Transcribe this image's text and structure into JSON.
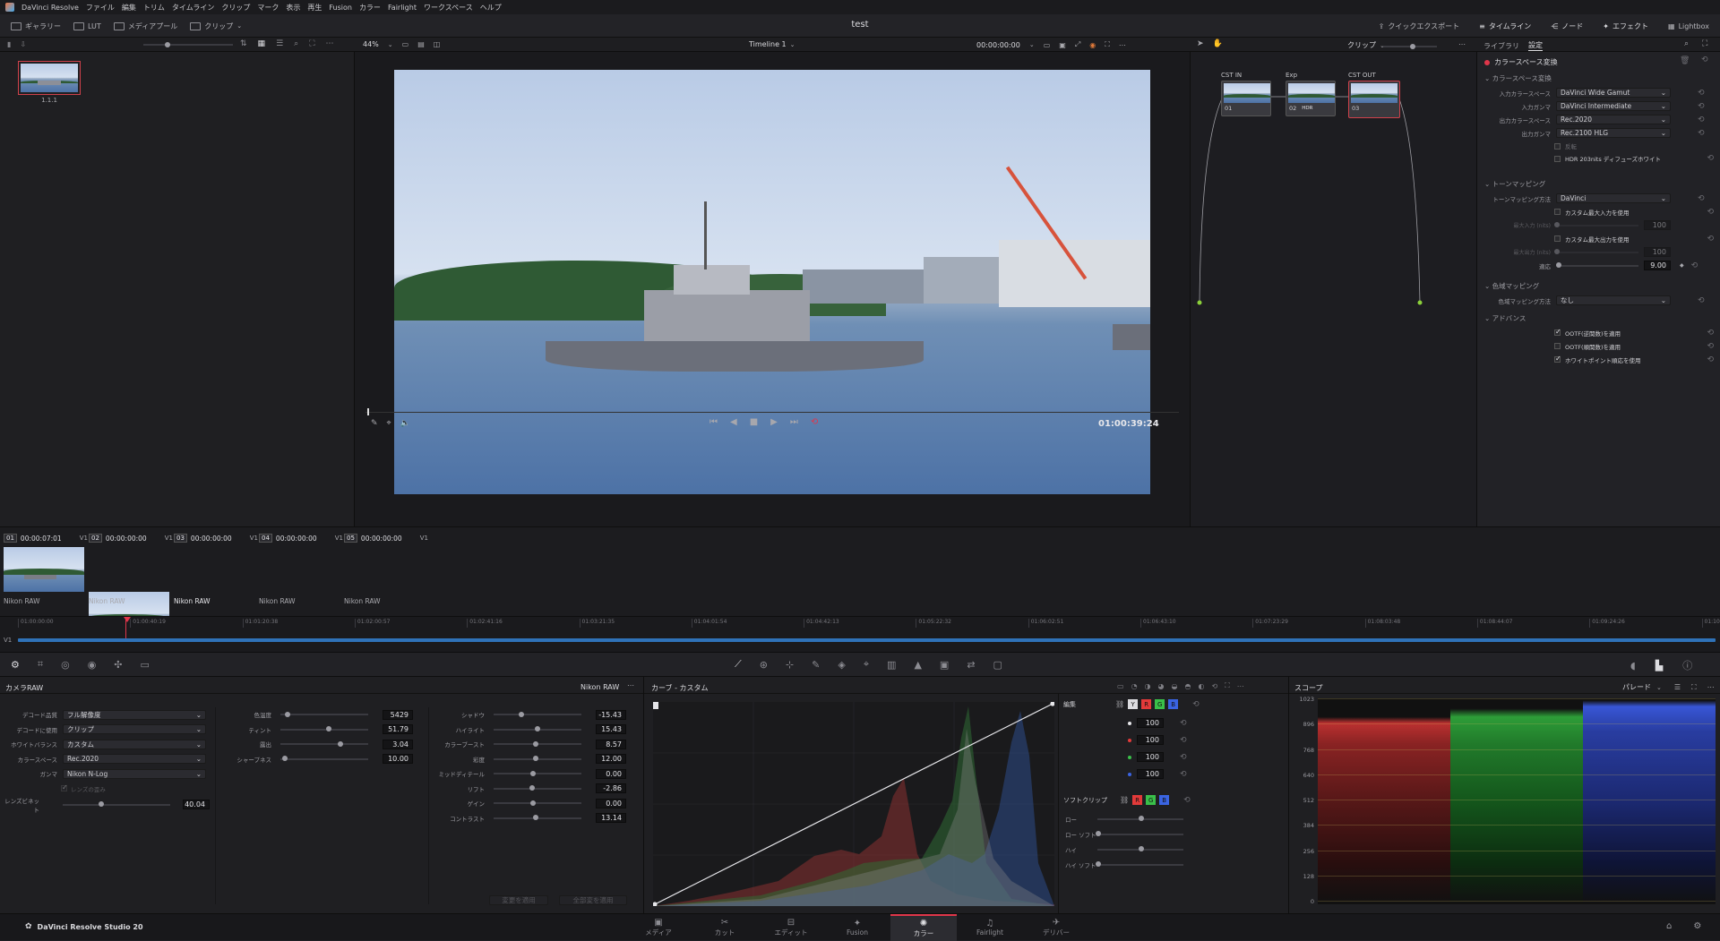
{
  "menubar": {
    "app": "DaVinci Resolve",
    "items": [
      "ファイル",
      "編集",
      "トリム",
      "タイムライン",
      "クリップ",
      "マーク",
      "表示",
      "再生",
      "Fusion",
      "カラー",
      "Fairlight",
      "ワークスペース",
      "ヘルプ"
    ]
  },
  "toolbar": {
    "left": [
      {
        "label": "ギャラリー"
      },
      {
        "label": "LUT"
      },
      {
        "label": "メディアプール"
      },
      {
        "label": "クリップ"
      }
    ],
    "project_title": "test",
    "right": [
      {
        "label": "クイックエクスポート"
      },
      {
        "label": "タイムライン"
      },
      {
        "label": "ノード"
      },
      {
        "label": "エフェクト"
      },
      {
        "label": "Lightbox"
      }
    ]
  },
  "viewer_bar": {
    "zoom": "44%",
    "timeline_name": "Timeline 1",
    "timecode": "00:00:00:00",
    "clip_menu": "クリップ"
  },
  "inspector_tabs": [
    "ライブラリ",
    "設定"
  ],
  "gallery": {
    "still_label": "1.1.1"
  },
  "viewer": {
    "current_timecode": "01:00:39:24"
  },
  "nodes": [
    {
      "label": "CST IN",
      "num": "01"
    },
    {
      "label": "Exp",
      "num": "02",
      "badge": "HDR"
    },
    {
      "label": "CST OUT",
      "num": "03"
    }
  ],
  "inspector": {
    "title": "カラースペース変換",
    "section1": "カラースペース変換",
    "rows": [
      {
        "label": "入力カラースペース",
        "value": "DaVinci Wide Gamut"
      },
      {
        "label": "入力ガンマ",
        "value": "DaVinci Intermediate"
      },
      {
        "label": "出力カラースペース",
        "value": "Rec.2020"
      },
      {
        "label": "出力ガンマ",
        "value": "Rec.2100 HLG"
      }
    ],
    "invert": "反転",
    "hdr_white": "HDR 203nits ディフューズホワイト",
    "section2": "トーンマッピング",
    "tone_method_label": "トーンマッピング方法",
    "tone_method": "DaVinci",
    "custom_in": "カスタム最大入力を使用",
    "max_in_label": "最大入力 (nits)",
    "max_in": "100",
    "custom_out": "カスタム最大出力を使用",
    "max_out_label": "最大出力 (nits)",
    "max_out": "100",
    "adapt_label": "適応",
    "adapt": "9.00",
    "section3": "色域マッピング",
    "gamut_label": "色域マッピング方法",
    "gamut": "なし",
    "section4": "アドバンス",
    "ootf_inv": "OOTF(逆関数)を適用",
    "ootf_fwd": "OOTF(順関数)を適用",
    "white_adapt": "ホワイトポイント順応を使用"
  },
  "clips": [
    {
      "num": "01",
      "tc": "00:00:07:01",
      "track": "V1",
      "codec": "Nikon RAW"
    },
    {
      "num": "02",
      "tc": "00:00:00:00",
      "track": "V1",
      "codec": "Nikon RAW"
    },
    {
      "num": "03",
      "tc": "00:00:00:00",
      "track": "V1",
      "codec": "Nikon RAW"
    },
    {
      "num": "04",
      "tc": "00:00:00:00",
      "track": "V1",
      "codec": "Nikon RAW"
    },
    {
      "num": "05",
      "tc": "00:00:00:00",
      "track": "V1",
      "codec": "Nikon RAW"
    }
  ],
  "timeline": {
    "track": "V1",
    "ticks": [
      "01:00:00:00",
      "01:00:40:19",
      "01:01:20:38",
      "01:02:00:57",
      "01:02:41:16",
      "01:03:21:35",
      "01:04:01:54",
      "01:04:42:13",
      "01:05:22:32",
      "01:06:02:51",
      "01:06:43:10",
      "01:07:23:29",
      "01:08:03:48",
      "01:08:44:07",
      "01:09:24:26",
      "01:10:0"
    ]
  },
  "raw": {
    "title": "カメラRAW",
    "badge": "Nikon RAW",
    "dropdowns": [
      {
        "label": "デコード品質",
        "value": "フル解像度"
      },
      {
        "label": "デコードに使用",
        "value": "クリップ"
      },
      {
        "label": "ホワイトバランス",
        "value": "カスタム"
      },
      {
        "label": "カラースペース",
        "value": "Rec.2020"
      },
      {
        "label": "ガンマ",
        "value": "Nikon N-Log"
      }
    ],
    "lens_corr": "レンズの歪み",
    "vignette_label": "レンズビネット",
    "vignette": "40.04",
    "col2": [
      {
        "label": "色温度",
        "value": "5429",
        "pos": 0.05
      },
      {
        "label": "ティント",
        "value": "51.79",
        "pos": 0.55
      },
      {
        "label": "露出",
        "value": "3.04",
        "pos": 0.7
      },
      {
        "label": "シャープネス",
        "value": "10.00",
        "pos": 0.02
      }
    ],
    "col3": [
      {
        "label": "シャドウ",
        "value": "-15.43",
        "pos": 0.3
      },
      {
        "label": "ハイライト",
        "value": "15.43",
        "pos": 0.5
      },
      {
        "label": "カラーブースト",
        "value": "8.57",
        "pos": 0.48
      },
      {
        "label": "彩度",
        "value": "12.00",
        "pos": 0.48
      },
      {
        "label": "ミッドディテール",
        "value": "0.00",
        "pos": 0.45
      },
      {
        "label": "リフト",
        "value": "-2.86",
        "pos": 0.44
      },
      {
        "label": "ゲイン",
        "value": "0.00",
        "pos": 0.45
      },
      {
        "label": "コントラスト",
        "value": "13.14",
        "pos": 0.48
      }
    ],
    "apply_btn1": "変更を適用",
    "apply_btn2": "全部変を適用"
  },
  "curves": {
    "title": "カーブ - カスタム",
    "edit_label": "編集",
    "vals": [
      "100",
      "100",
      "100",
      "100"
    ],
    "softclip_label": "ソフトクリップ",
    "softclip_rows": [
      "ロー",
      "ロー ソフト",
      "ハイ",
      "ハイ ソフト"
    ]
  },
  "scopes": {
    "title": "スコープ",
    "mode": "パレード",
    "scale": [
      "1023",
      "896",
      "768",
      "640",
      "512",
      "384",
      "256",
      "128",
      "0"
    ]
  },
  "bottombar": {
    "app": "DaVinci Resolve Studio 20",
    "pages": [
      "メディア",
      "カット",
      "エディット",
      "Fusion",
      "カラー",
      "Fairlight",
      "デリバー"
    ],
    "active_page": "カラー"
  },
  "colors": {
    "accent": "#e0364a",
    "red": "#e23a3a",
    "green": "#3ac04a",
    "blue": "#3a64e2",
    "timeline_bar": "#2f72b8"
  }
}
